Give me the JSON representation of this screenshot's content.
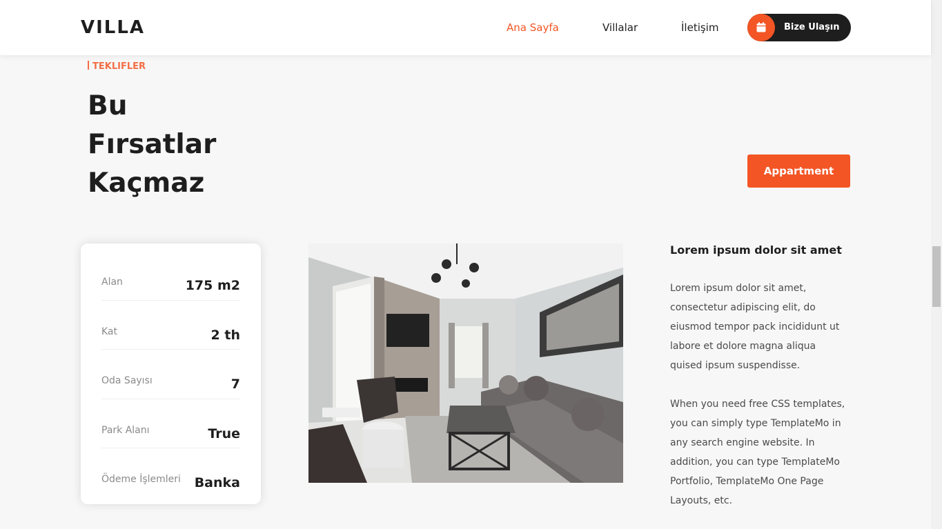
{
  "header": {
    "logo": "VILLA",
    "nav": [
      "Ana Sayfa",
      "Villalar",
      "İletişim"
    ],
    "cta": "Bize Ulaşın"
  },
  "section": {
    "tag": "TEKLIFLER",
    "headline": [
      "Bu",
      "Fırsatlar",
      "Kaçmaz"
    ],
    "button": "Appartment"
  },
  "info": [
    {
      "label": "Alan",
      "value": "175 m2"
    },
    {
      "label": "Kat",
      "value": "2 th"
    },
    {
      "label": "Oda Sayısı",
      "value": "7"
    },
    {
      "label": "Park Alanı",
      "value": "True"
    },
    {
      "label": "Ödeme İşlemleri",
      "value": "Banka"
    }
  ],
  "description": {
    "title": "Lorem ipsum dolor sit amet",
    "p1": [
      "Lorem ipsum dolor sit amet,",
      "consectetur adipiscing elit, do",
      "eiusmod tempor pack incididunt ut",
      "labore et dolore magna aliqua",
      "quised ipsum suspendisse."
    ],
    "p2": [
      "When you need free CSS templates,",
      "you can simply type TemplateMo in",
      "any search engine website. In",
      "addition, you can type TemplateMo",
      "Portfolio, TemplateMo One Page",
      "Layouts, etc."
    ]
  },
  "colors": {
    "accent": "#f35525",
    "dark": "#1e1e1e",
    "background": "#f7f7f7"
  },
  "icons": {
    "cta_icon": "calendar-icon"
  }
}
